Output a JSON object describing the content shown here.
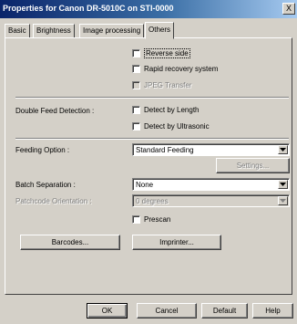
{
  "window": {
    "title": "Properties for Canon DR-5010C on STI-0000",
    "close_label": "X"
  },
  "tabs": [
    {
      "label": "Basic"
    },
    {
      "label": "Brightness"
    },
    {
      "label": "Image processing"
    },
    {
      "label": "Others"
    }
  ],
  "options": {
    "reverse_side": "Reverse side",
    "rapid_recovery": "Rapid recovery system",
    "jpeg_transfer": "JPEG Transfer"
  },
  "double_feed": {
    "label": "Double Feed Detection :",
    "by_length": "Detect by Length",
    "by_ultrasonic": "Detect by Ultrasonic"
  },
  "feeding": {
    "label": "Feeding Option :",
    "value": "Standard Feeding",
    "settings_button": "Settings..."
  },
  "batch": {
    "label": "Batch Separation :",
    "value": "None"
  },
  "patchcode": {
    "label": "Patchcode Orientation :",
    "value": "0 degrees"
  },
  "prescan": {
    "label": "Prescan"
  },
  "buttons": {
    "barcodes": "Barcodes...",
    "imprinter": "Imprinter...",
    "ok": "OK",
    "cancel": "Cancel",
    "default": "Default",
    "help": "Help"
  }
}
